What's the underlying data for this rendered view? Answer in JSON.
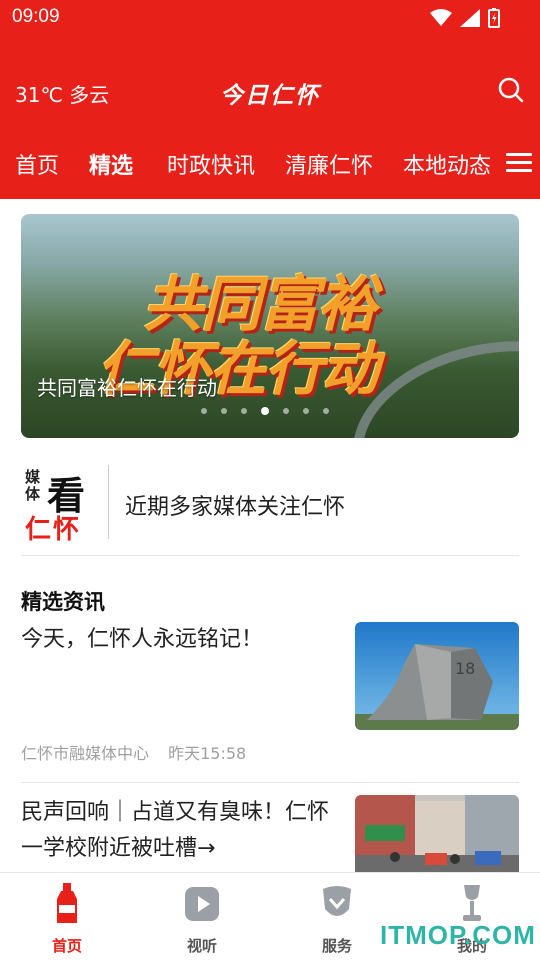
{
  "status_bar": {
    "time": "09:09"
  },
  "header": {
    "weather": "31℃ 多云",
    "logo_text": "今日仁怀",
    "icons": [
      "search-icon"
    ]
  },
  "tabs": [
    {
      "label": "首页",
      "active": false
    },
    {
      "label": "精选",
      "active": true
    },
    {
      "label": "时政快讯",
      "active": false
    },
    {
      "label": "清廉仁怀",
      "active": false
    },
    {
      "label": "本地动态",
      "active": false
    }
  ],
  "banner": {
    "headline_line1": "共同富裕",
    "headline_line2": "仁怀在行动",
    "caption": "共同富裕仁怀在行动",
    "slide_count": 7,
    "active_slide": 4
  },
  "media": {
    "logo_top": "媒体",
    "logo_big": "看",
    "logo_bottom": "仁怀",
    "text": "近期多家媒体关注仁怀"
  },
  "section": {
    "title": "精选资讯"
  },
  "news": [
    {
      "title": "今天，仁怀人永远铭记！",
      "source": "仁怀市融媒体中心",
      "time": "昨天15:58",
      "image": "monument-photo"
    },
    {
      "title": "民声回响｜占道又有臭味！仁怀一学校附近被吐槽→",
      "image": "street-photo"
    }
  ],
  "bottom_nav": [
    {
      "label": "首页",
      "icon": "bottle-icon",
      "active": true
    },
    {
      "label": "视听",
      "icon": "play-icon",
      "active": false
    },
    {
      "label": "服务",
      "icon": "service-icon",
      "active": false
    },
    {
      "label": "我的",
      "icon": "profile-icon",
      "active": false
    }
  ],
  "watermark": "ITMOP.COM",
  "colors": {
    "brand_red": "#e8201a",
    "text": "#222222",
    "meta_gray": "#a0a0a0"
  }
}
